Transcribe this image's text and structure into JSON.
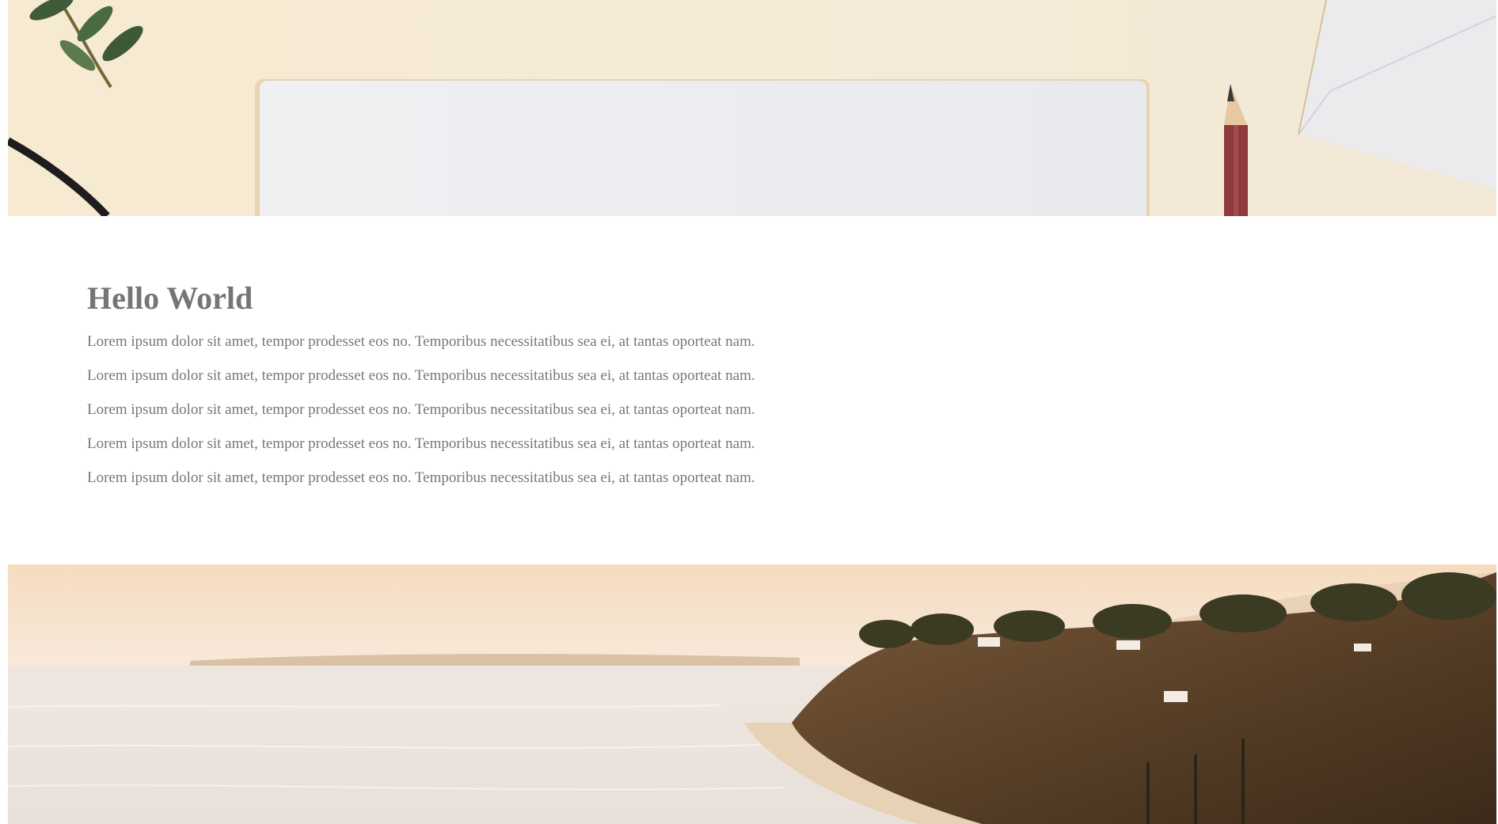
{
  "article": {
    "title": "Hello World",
    "paragraphs": [
      "Lorem ipsum dolor sit amet, tempor prodesset eos no. Temporibus necessitatibus sea ei, at tantas oporteat nam.",
      "Lorem ipsum dolor sit amet, tempor prodesset eos no. Temporibus necessitatibus sea ei, at tantas oporteat nam.",
      "Lorem ipsum dolor sit amet, tempor prodesset eos no. Temporibus necessitatibus sea ei, at tantas oporteat nam.",
      "Lorem ipsum dolor sit amet, tempor prodesset eos no. Temporibus necessitatibus sea ei, at tantas oporteat nam.",
      "Lorem ipsum dolor sit amet, tempor prodesset eos no. Temporibus necessitatibus sea ei, at tantas oporteat nam."
    ]
  },
  "colors": {
    "text": "#777777",
    "heading": "#757575",
    "background": "#ffffff"
  }
}
